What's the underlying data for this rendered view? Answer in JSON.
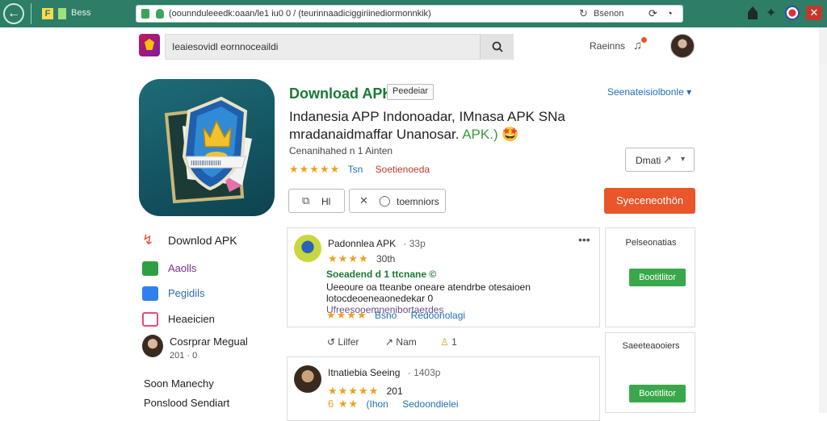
{
  "browser": {
    "tab_label": "Bess",
    "url": "(oounnduleeedk:oaan/le1 iu0 0 / (teurinnaadiciggiriinediormonnkik)",
    "addr_search": "Bsenon",
    "ext_letter": "F"
  },
  "header": {
    "search_text": "Ieaiesovidl eornnoceaildi",
    "link": "Raeinns"
  },
  "app": {
    "title": "Download APK",
    "badge": "Peedeiar",
    "lang": "Seenateisiolbonle",
    "name_part1": "Indanesia APP Indonoadar, IMnasa APK SNa mradanaidmaffar Unanosar.",
    "name_highlight": "APK.)",
    "name_emoji": "🤩",
    "developer": "Cenanihahed n 1 Ainten",
    "stars": "★★★★★",
    "rating_count": "Tsn",
    "rating_tag": "Soetienoeda",
    "share_label": "Dmati",
    "like_label": "Hl",
    "reviews_label": "toemniors",
    "download_label": "Syeceneothön"
  },
  "nav": {
    "items": [
      {
        "label": "Downlod APK",
        "color": "#e74c3c"
      },
      {
        "label": "Aaolls",
        "color": "#2ea043"
      },
      {
        "label": "Pegidils",
        "color": "#2f80ed"
      },
      {
        "label": "Heaeicien",
        "color": "#e84a7a"
      }
    ],
    "user_name": "Cosrprar Megual",
    "user_meta": "201 · 0",
    "footer1": "Soon Manechy",
    "footer2": "Ponslood Sendiart"
  },
  "reviews": [
    {
      "author": "Padonnlea APK",
      "time": "· 33p",
      "stars": "★★★★",
      "stars_small": "30th",
      "headline": "Soeadend d 1 ttcnane ©",
      "body_part1": "Ueeoure oa tteanbe oneare atendrbe otesaioen lotocdeoeneaonedekar 0",
      "body_part2": "Ufreesooemnenibortaerdes",
      "tag1": "Bsno",
      "tag2": "Redoonolagi"
    },
    {
      "author": "Itnatiebia Seeing",
      "time": "· 1403p",
      "stars": "★★★★★",
      "stars_small": "201",
      "tag_stars": "6 ★★",
      "tag1": "(Ihon",
      "tag2": "Sedoondielei"
    }
  ],
  "review_actions": {
    "like": "Lilfer",
    "share": "Nam",
    "count": "1"
  },
  "side": [
    {
      "title": "Pelseonatias",
      "button": "Bootitlitor"
    },
    {
      "title": "Saeeteaooiers",
      "button": "Bootitlitor"
    }
  ],
  "colors": {
    "chrome": "#2e7d66",
    "accent_orange": "#e8562a",
    "accent_green": "#3aa84a",
    "title_green": "#1b7a34",
    "link_blue": "#1f6fb8"
  },
  "icons": [
    "back-arrow-icon",
    "lock-icon",
    "shield-icon",
    "reload-icon",
    "search-icon",
    "clock-icon",
    "home-icon",
    "star-icon",
    "flag-icon",
    "close-icon",
    "bell-icon",
    "share-icon",
    "like-icon",
    "comment-icon"
  ]
}
